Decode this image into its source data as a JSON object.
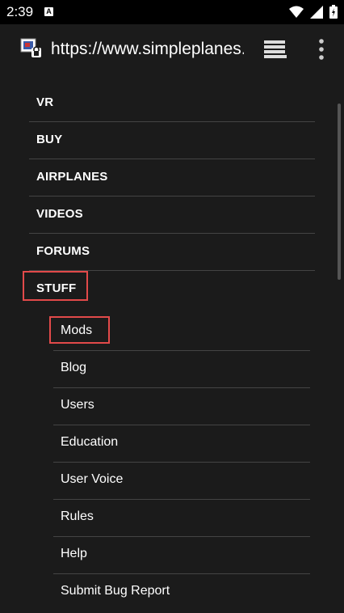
{
  "status_bar": {
    "time": "2:39",
    "notif_badge": "A"
  },
  "browser": {
    "url": "https://www.simpleplanes.com"
  },
  "nav": {
    "top_items": [
      {
        "label": "VR"
      },
      {
        "label": "BUY"
      },
      {
        "label": "AIRPLANES"
      },
      {
        "label": "VIDEOS"
      },
      {
        "label": "FORUMS"
      },
      {
        "label": "STUFF"
      }
    ],
    "sub_items": [
      {
        "label": "Mods"
      },
      {
        "label": "Blog"
      },
      {
        "label": "Users"
      },
      {
        "label": "Education"
      },
      {
        "label": "User Voice"
      },
      {
        "label": "Rules"
      },
      {
        "label": "Help"
      },
      {
        "label": "Submit Bug Report"
      }
    ]
  },
  "colors": {
    "background": "#1b1b1b",
    "divider": "#444444",
    "highlight": "#e24a4a"
  }
}
